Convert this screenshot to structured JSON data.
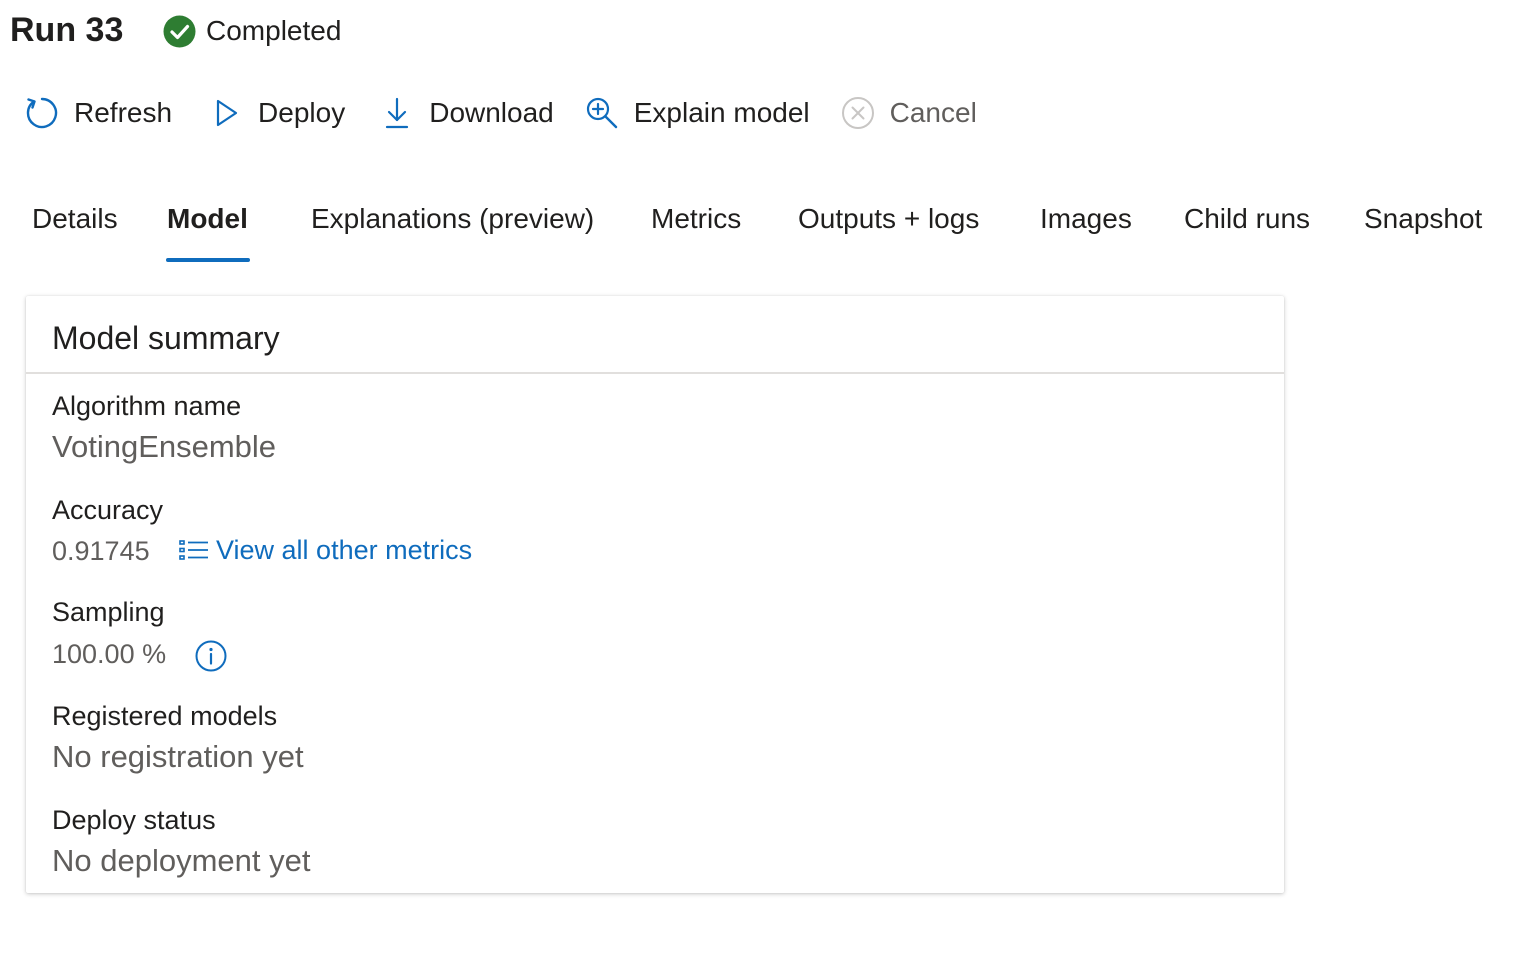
{
  "header": {
    "run_title": "Run 33",
    "status": "Completed",
    "status_color": "#2e7d32"
  },
  "toolbar": {
    "refresh": "Refresh",
    "deploy": "Deploy",
    "download": "Download",
    "explain": "Explain model",
    "cancel": "Cancel",
    "accent_color": "#0f6cbd"
  },
  "tabs": [
    {
      "label": "Details"
    },
    {
      "label": "Model",
      "active": true
    },
    {
      "label": "Explanations (preview)"
    },
    {
      "label": "Metrics"
    },
    {
      "label": "Outputs + logs"
    },
    {
      "label": "Images"
    },
    {
      "label": "Child runs"
    },
    {
      "label": "Snapshot"
    }
  ],
  "card": {
    "title": "Model summary",
    "algorithm_label": "Algorithm name",
    "algorithm_value": "VotingEnsemble",
    "accuracy_label": "Accuracy",
    "accuracy_value": "0.91745",
    "metrics_link": "View all other metrics",
    "sampling_label": "Sampling",
    "sampling_value": "100.00 %",
    "registered_label": "Registered models",
    "registered_value": "No registration yet",
    "deploy_label": "Deploy status",
    "deploy_value": "No deployment yet"
  },
  "icons": {
    "status": "check-circle-icon",
    "refresh": "refresh-icon",
    "deploy": "play-icon",
    "download": "download-icon",
    "explain": "zoom-in-icon",
    "cancel": "cancel-circle-icon",
    "metrics": "list-icon",
    "info": "info-icon"
  }
}
